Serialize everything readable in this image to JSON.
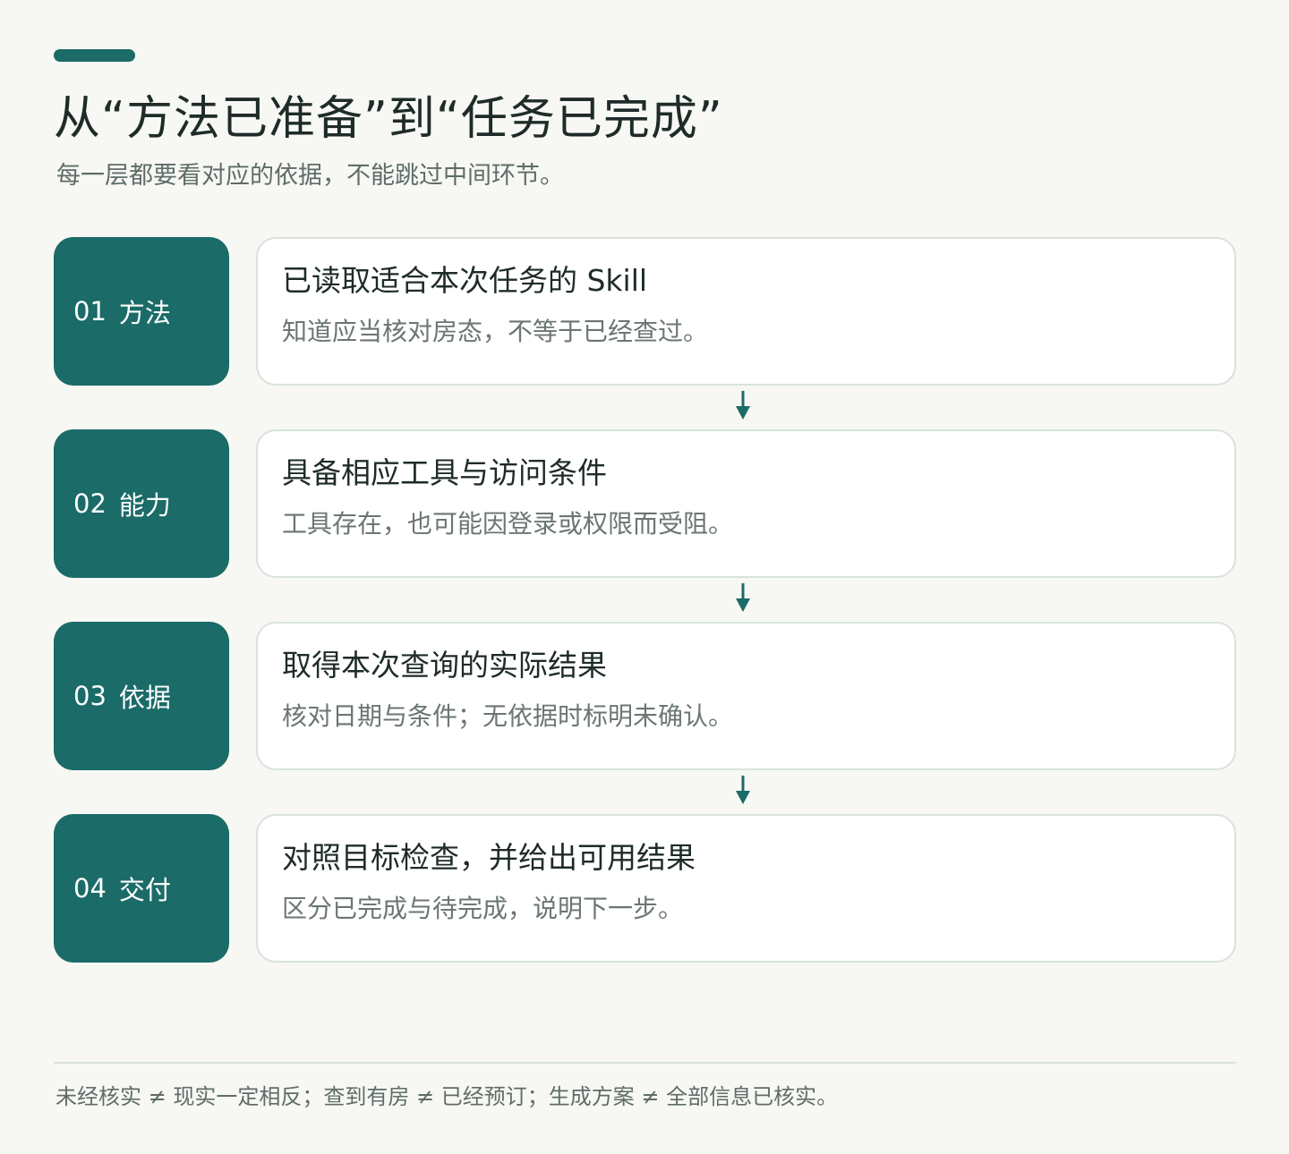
{
  "header": {
    "title": "从“方法已准备”到“任务已完成”",
    "subtitle": "每一层都要看对应的依据，不能跳过中间环节。"
  },
  "steps": [
    {
      "number": "01",
      "label": "方法",
      "title": "已读取适合本次任务的 Skill",
      "description": "知道应当核对房态，不等于已经查过。"
    },
    {
      "number": "02",
      "label": "能力",
      "title": "具备相应工具与访问条件",
      "description": "工具存在，也可能因登录或权限而受阻。"
    },
    {
      "number": "03",
      "label": "依据",
      "title": "取得本次查询的实际结果",
      "description": "核对日期与条件；无依据时标明未确认。"
    },
    {
      "number": "04",
      "label": "交付",
      "title": "对照目标检查，并给出可用结果",
      "description": "区分已完成与待完成，说明下一步。"
    }
  ],
  "footer": {
    "note": "未经核实 ≠ 现实一定相反；查到有房 ≠ 已经预订；生成方案 ≠ 全部信息已核实。"
  },
  "colors": {
    "accent": "#1b6b68",
    "background": "#f7f8f3",
    "card": "#ffffff",
    "card_border": "#d9e2de",
    "title_text": "#1e2b29",
    "muted_text": "#6b7673"
  },
  "icons": {
    "connector": "arrow-down-icon"
  }
}
